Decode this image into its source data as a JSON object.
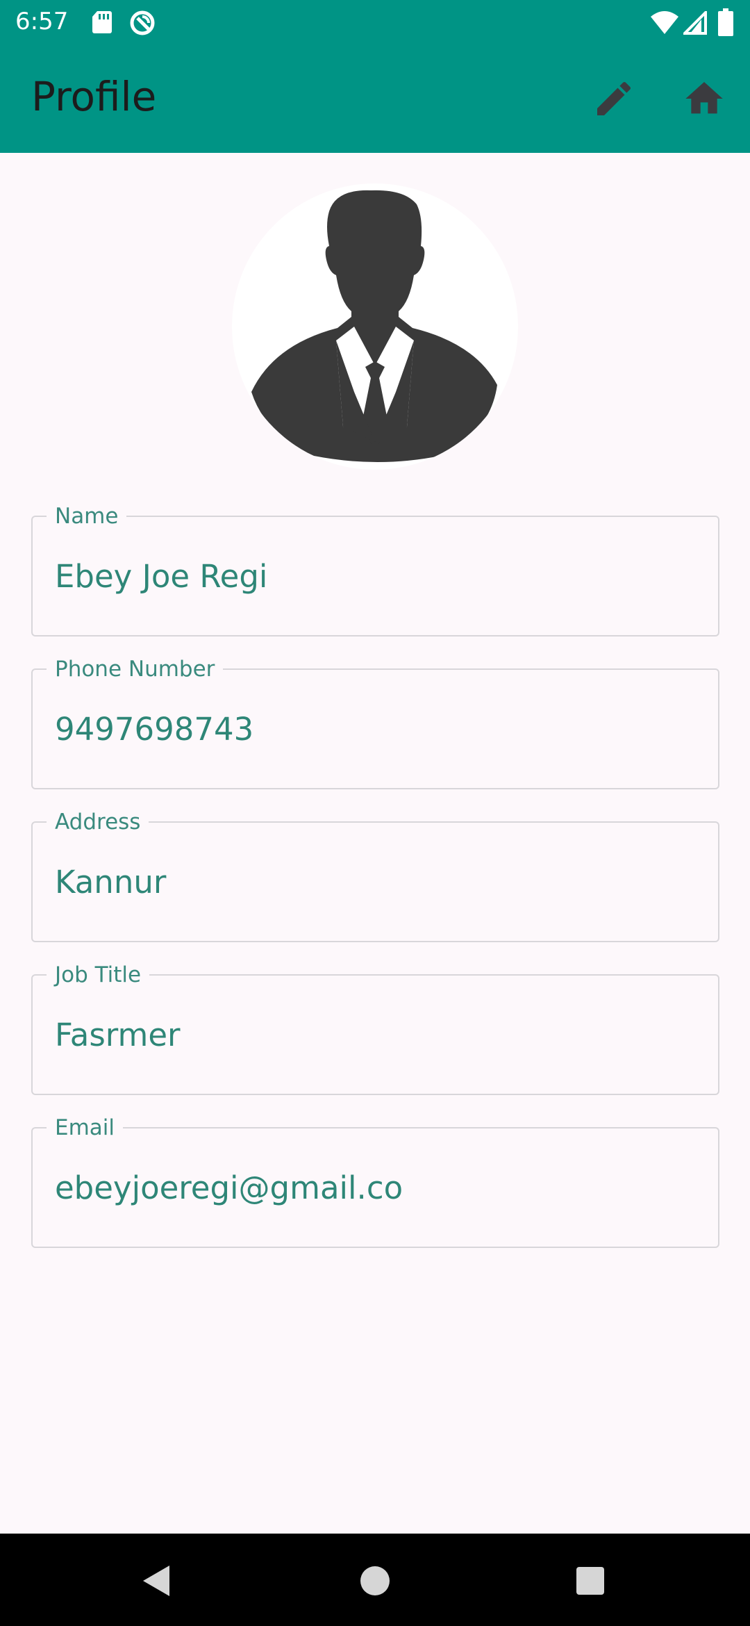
{
  "status_bar": {
    "time": "6:57",
    "icons": [
      "sd-card-icon",
      "sync-icon",
      "wifi-icon",
      "signal-icon",
      "battery-icon"
    ]
  },
  "app_bar": {
    "title": "Profile",
    "background_color": "#009485",
    "actions": [
      "edit-icon",
      "home-icon"
    ]
  },
  "avatar": {
    "icon": "person-silhouette-icon"
  },
  "fields": [
    {
      "label": "Name",
      "value": "Ebey Joe Regi"
    },
    {
      "label": "Phone Number",
      "value": "9497698743"
    },
    {
      "label": "Address",
      "value": "Kannur"
    },
    {
      "label": "Job Title",
      "value": "Fasrmer"
    },
    {
      "label": "Email",
      "value": "ebeyjoeregi@gmail.co"
    }
  ],
  "nav_bar": {
    "buttons": [
      "back-icon",
      "home-circle-icon",
      "recents-icon"
    ]
  },
  "colors": {
    "accent": "#009485",
    "field_text": "#2e8677",
    "background": "#fdf8fb"
  }
}
